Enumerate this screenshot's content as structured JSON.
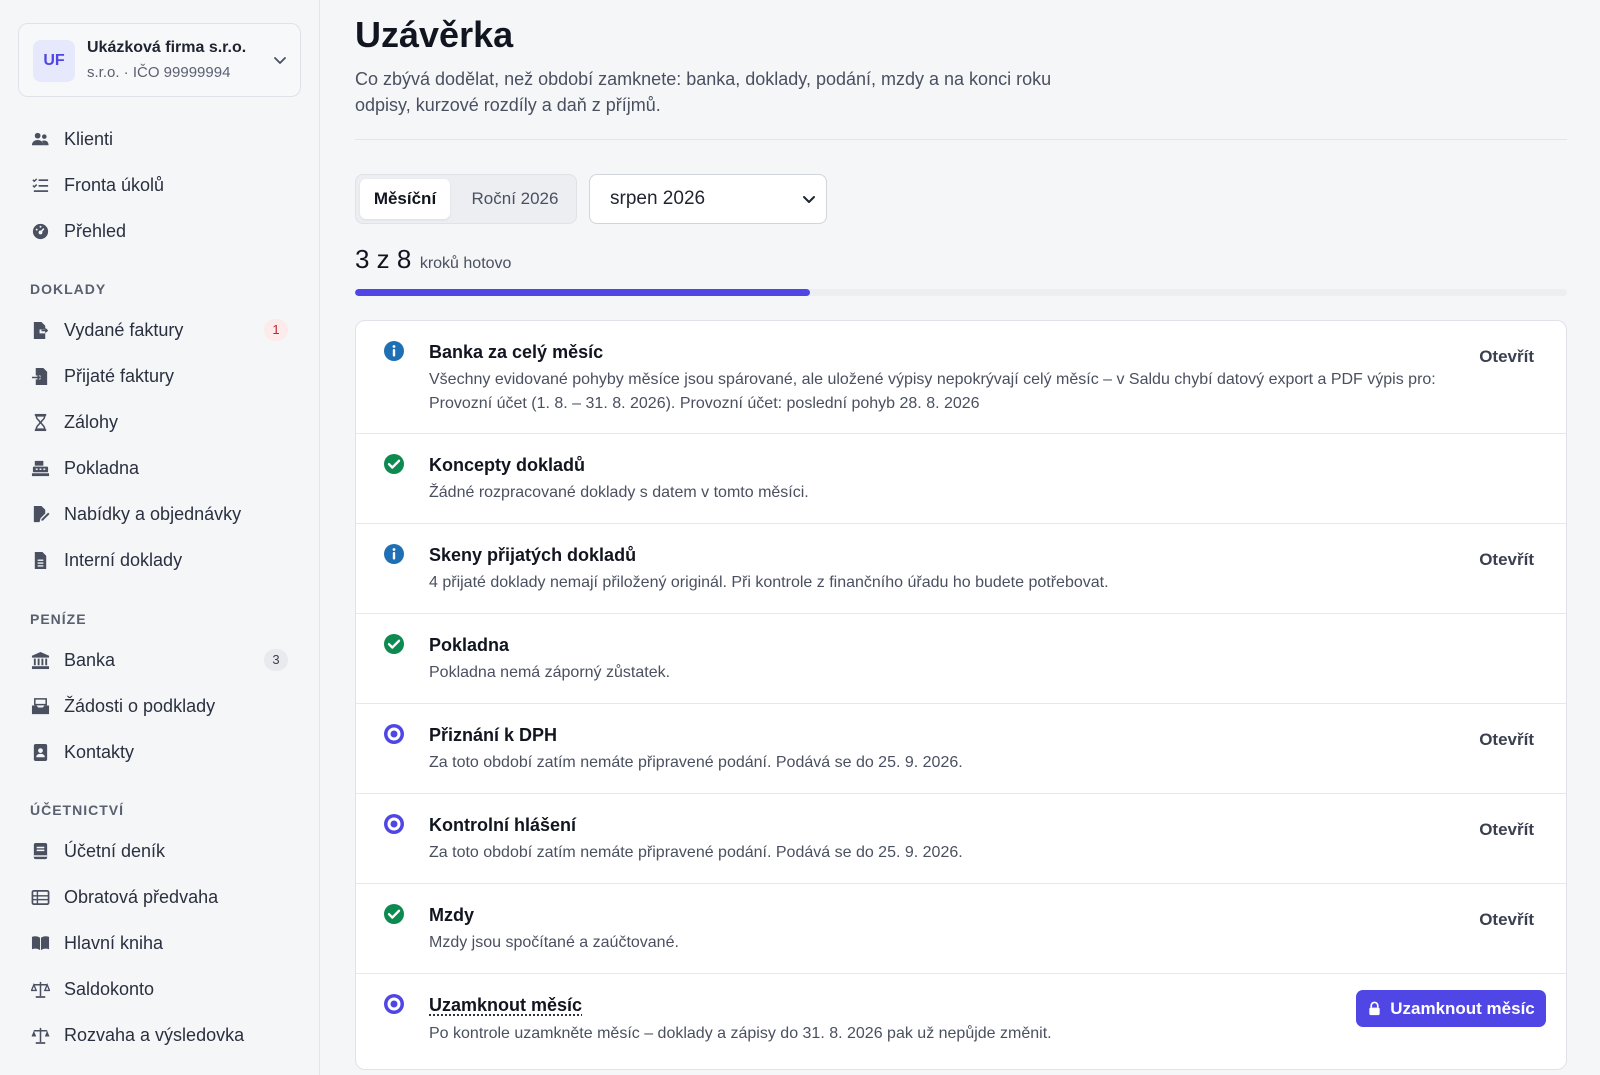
{
  "org": {
    "initials": "UF",
    "name": "Ukázková firma s.r.o.",
    "sub": "s.r.o. · IČO 99999994"
  },
  "nav": {
    "top": [
      {
        "label": "Klienti",
        "icon": "users-icon"
      },
      {
        "label": "Fronta úkolů",
        "icon": "task-list-icon"
      },
      {
        "label": "Přehled",
        "icon": "dashboard-icon"
      }
    ],
    "sections": [
      {
        "label": "DOKLADY",
        "items": [
          {
            "label": "Vydané faktury",
            "icon": "invoice-out-icon",
            "badge": "1"
          },
          {
            "label": "Přijaté faktury",
            "icon": "invoice-in-icon"
          },
          {
            "label": "Zálohy",
            "icon": "hourglass-icon"
          },
          {
            "label": "Pokladna",
            "icon": "cash-register-icon"
          },
          {
            "label": "Nabídky a objednávky",
            "icon": "order-icon"
          },
          {
            "label": "Interní doklady",
            "icon": "document-icon"
          }
        ]
      },
      {
        "label": "PENÍZE",
        "items": [
          {
            "label": "Banka",
            "icon": "bank-icon",
            "badge": "3"
          },
          {
            "label": "Žádosti o podklady",
            "icon": "inbox-icon"
          },
          {
            "label": "Kontakty",
            "icon": "contact-icon"
          }
        ]
      },
      {
        "label": "ÚČETNICTVÍ",
        "items": [
          {
            "label": "Účetní deník",
            "icon": "journal-icon"
          },
          {
            "label": "Obratová předvaha",
            "icon": "table-icon"
          },
          {
            "label": "Hlavní kniha",
            "icon": "book-icon"
          },
          {
            "label": "Saldokonto",
            "icon": "scale-icon"
          },
          {
            "label": "Rozvaha a výsledovka",
            "icon": "balance-icon"
          }
        ]
      }
    ]
  },
  "page": {
    "title": "Uzávěrka",
    "description": "Co zbývá dodělat, než období zamknete: banka, doklady, podání, mzdy a na konci roku odpisy, kurzové rozdíly a daň z příjmů."
  },
  "tabs": [
    {
      "label": "Měsíční",
      "active": true
    },
    {
      "label": "Roční 2026",
      "active": false
    }
  ],
  "period": {
    "selected": "srpen 2026"
  },
  "progress": {
    "done": 3,
    "total": 8,
    "text": "3 z 8",
    "label": "kroků hotovo",
    "accent": "#4f46e5"
  },
  "colors": {
    "info": "#1f6fb5",
    "done": "#0d8a4f",
    "pending": "#4f46e5"
  },
  "steps": [
    {
      "status": "info",
      "title": "Banka za celý měsíc",
      "desc": "Všechny evidované pohyby měsíce jsou spárované, ale uložené výpisy nepokrývají celý měsíc – v Saldu chybí datový export a PDF výpis pro: Provozní účet (1. 8. – 31. 8. 2026). Provozní účet: poslední pohyb 28. 8. 2026",
      "action": "Otevřít"
    },
    {
      "status": "done",
      "title": "Koncepty dokladů",
      "desc": "Žádné rozpracované doklady s datem v tomto měsíci.",
      "action": ""
    },
    {
      "status": "info",
      "title": "Skeny přijatých dokladů",
      "desc": "4 přijaté doklady nemají přiložený originál. Při kontrole z finančního úřadu ho budete potřebovat.",
      "action": "Otevřít"
    },
    {
      "status": "done",
      "title": "Pokladna",
      "desc": "Pokladna nemá záporný zůstatek.",
      "action": ""
    },
    {
      "status": "pending",
      "title": "Přiznání k DPH",
      "desc": "Za toto období zatím nemáte připravené podání. Podává se do 25. 9. 2026.",
      "action": "Otevřít"
    },
    {
      "status": "pending",
      "title": "Kontrolní hlášení",
      "desc": "Za toto období zatím nemáte připravené podání. Podává se do 25. 9. 2026.",
      "action": "Otevřít"
    },
    {
      "status": "done",
      "title": "Mzdy",
      "desc": "Mzdy jsou spočítané a zaúčtované.",
      "action": "Otevřít"
    },
    {
      "status": "pending",
      "title": "Uzamknout měsíc",
      "desc": "Po kontrole uzamkněte měsíc – doklady a zápisy do 31. 8. 2026 pak už nepůjde změnit.",
      "button": "Uzamknout měsíc"
    }
  ]
}
